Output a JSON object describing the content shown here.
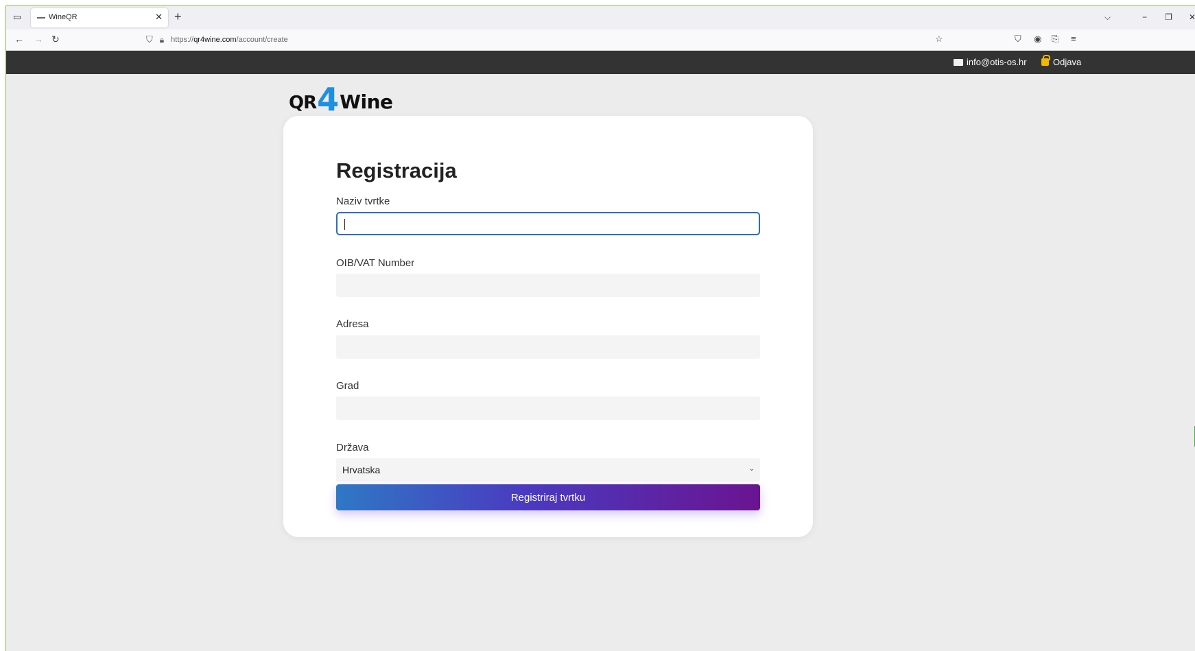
{
  "browser": {
    "tab_title": "WineQR",
    "url_scheme": "https://",
    "url_host": "qr4wine.com",
    "url_path": "/account/create"
  },
  "topbar": {
    "email": "info@otis-os.hr",
    "logout": "Odjava"
  },
  "logo": {
    "part1": "QR",
    "part2": "4",
    "part3": "Wine"
  },
  "form": {
    "title": "Registracija",
    "fields": {
      "company_name": {
        "label": "Naziv tvrtke",
        "value": ""
      },
      "vat": {
        "label": "OIB/VAT Number",
        "value": ""
      },
      "address": {
        "label": "Adresa",
        "value": ""
      },
      "city": {
        "label": "Grad",
        "value": ""
      },
      "country": {
        "label": "Država",
        "value": "Hrvatska"
      }
    },
    "submit_label": "Registriraj tvrtku"
  },
  "colors": {
    "topbar_bg": "#333333",
    "logo_accent": "#1f8fe0",
    "focus_border": "#2b6cc4",
    "button_gradient_start": "#2f78c4",
    "button_gradient_end": "#6a1490"
  }
}
